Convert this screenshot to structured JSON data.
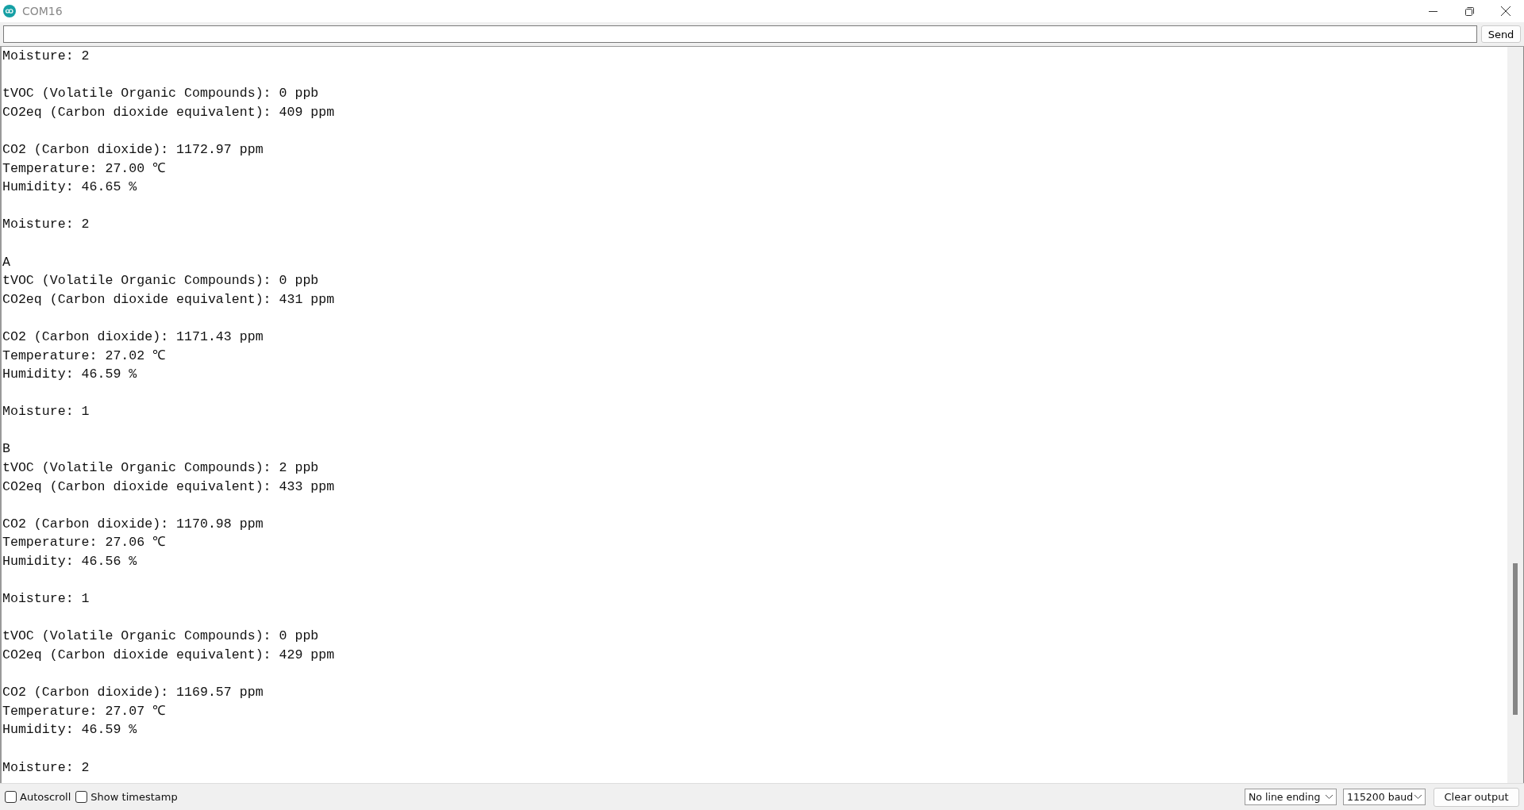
{
  "window": {
    "title": "COM16"
  },
  "send_button": "Send",
  "output": [
    [
      "Moisture: 2"
    ],
    [
      "tVOC (Volatile Organic Compounds): 0 ppb",
      "CO2eq (Carbon dioxide equivalent): 409 ppm"
    ],
    [
      "CO2 (Carbon dioxide): 1172.97 ppm",
      "Temperature: 27.00 ℃",
      "Humidity: 46.65 %"
    ],
    [
      "Moisture: 2"
    ],
    [
      "A",
      "tVOC (Volatile Organic Compounds): 0 ppb",
      "CO2eq (Carbon dioxide equivalent): 431 ppm"
    ],
    [
      "CO2 (Carbon dioxide): 1171.43 ppm",
      "Temperature: 27.02 ℃",
      "Humidity: 46.59 %"
    ],
    [
      "Moisture: 1"
    ],
    [
      "B",
      "tVOC (Volatile Organic Compounds): 2 ppb",
      "CO2eq (Carbon dioxide equivalent): 433 ppm"
    ],
    [
      "CO2 (Carbon dioxide): 1170.98 ppm",
      "Temperature: 27.06 ℃",
      "Humidity: 46.56 %"
    ],
    [
      "Moisture: 1"
    ],
    [
      "tVOC (Volatile Organic Compounds): 0 ppb",
      "CO2eq (Carbon dioxide equivalent): 429 ppm"
    ],
    [
      "CO2 (Carbon dioxide): 1169.57 ppm",
      "Temperature: 27.07 ℃",
      "Humidity: 46.59 %"
    ],
    [
      "Moisture: 2"
    ]
  ],
  "footer": {
    "checkboxes": [
      {
        "label": "Autoscroll",
        "checked": false
      },
      {
        "label": "Show timestamp",
        "checked": false
      }
    ],
    "line_ending": "No line ending",
    "baud_rate": "115200 baud",
    "clear_button": "Clear output"
  }
}
